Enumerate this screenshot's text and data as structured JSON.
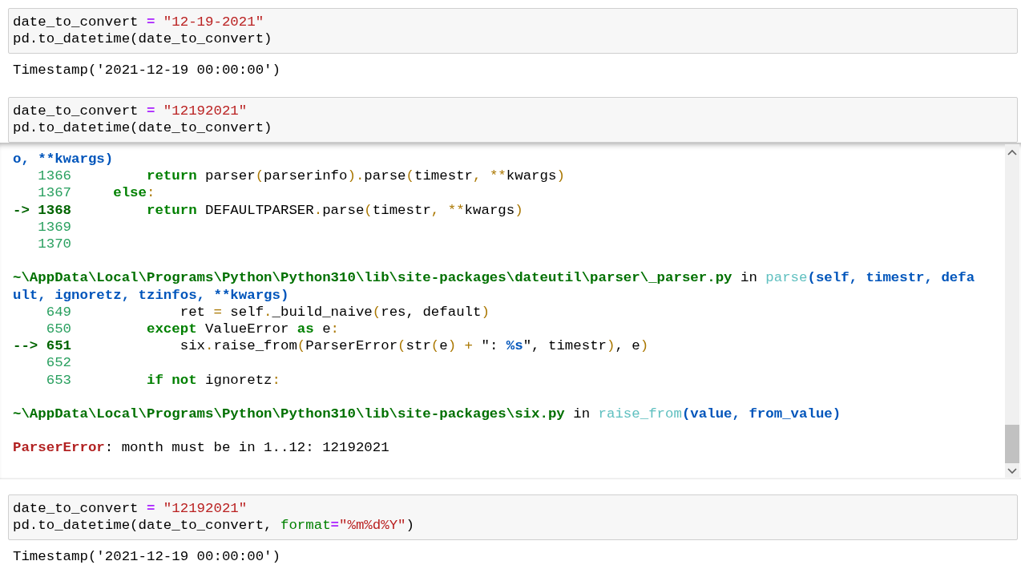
{
  "cells": [
    {
      "input": [
        [
          {
            "text": "date_to_convert ",
            "kind": "plain"
          },
          {
            "text": "=",
            "kind": "op"
          },
          {
            "text": " \"12-19-2021\"",
            "kind": "str"
          }
        ],
        [
          {
            "text": "pd.to_datetime(date_to_convert)",
            "kind": "plain"
          }
        ]
      ],
      "output": {
        "kind": "text",
        "lines": [
          "Timestamp('2021-12-19 00:00:00')"
        ]
      }
    },
    {
      "input": [
        [
          {
            "text": "date_to_convert ",
            "kind": "plain"
          },
          {
            "text": "=",
            "kind": "op"
          },
          {
            "text": " \"12192021\"",
            "kind": "str"
          }
        ],
        [
          {
            "text": "pd.to_datetime(date_to_convert)",
            "kind": "plain"
          }
        ]
      ],
      "output": {
        "kind": "traceback",
        "groups": [
          [
            [
              {
                "text": "o, **kwargs)",
                "kind": "arg"
              }
            ],
            [
              {
                "text": "   1366",
                "kind": "lineno"
              },
              {
                "text": "         return",
                "kind": "kw"
              },
              {
                "text": " parser",
                "kind": "plain"
              },
              {
                "text": "(",
                "kind": "paren"
              },
              {
                "text": "parserinfo",
                "kind": "plain"
              },
              {
                "text": ").",
                "kind": "paren"
              },
              {
                "text": "parse",
                "kind": "plain"
              },
              {
                "text": "(",
                "kind": "paren"
              },
              {
                "text": "timestr",
                "kind": "plain"
              },
              {
                "text": ", **",
                "kind": "paren"
              },
              {
                "text": "kwargs",
                "kind": "plain"
              },
              {
                "text": ")",
                "kind": "paren"
              }
            ],
            [
              {
                "text": "   1367",
                "kind": "lineno"
              },
              {
                "text": "     else",
                "kind": "kw"
              },
              {
                "text": ":",
                "kind": "paren"
              }
            ],
            [
              {
                "text": "-> 1368",
                "kind": "cur"
              },
              {
                "text": "         return",
                "kind": "kw"
              },
              {
                "text": " DEFAULTPARSER",
                "kind": "plain"
              },
              {
                "text": ".",
                "kind": "paren"
              },
              {
                "text": "parse",
                "kind": "plain"
              },
              {
                "text": "(",
                "kind": "paren"
              },
              {
                "text": "timestr",
                "kind": "plain"
              },
              {
                "text": ", **",
                "kind": "paren"
              },
              {
                "text": "kwargs",
                "kind": "plain"
              },
              {
                "text": ")",
                "kind": "paren"
              }
            ],
            [
              {
                "text": "   1369",
                "kind": "lineno"
              }
            ],
            [
              {
                "text": "   1370",
                "kind": "lineno"
              }
            ]
          ],
          [
            [
              {
                "text": "~\\AppData\\Local\\Programs\\Python\\Python310\\lib\\site-packages\\dateutil\\parser\\_parser.py",
                "kind": "path"
              },
              {
                "text": " in ",
                "kind": "plain"
              },
              {
                "text": "parse",
                "kind": "func"
              },
              {
                "text": "(self, timestr, defa",
                "kind": "arg"
              }
            ],
            [
              {
                "text": "ult, ignoretz, tzinfos, **kwargs)",
                "kind": "arg"
              }
            ],
            [
              {
                "text": "    649",
                "kind": "lineno"
              },
              {
                "text": "             ret ",
                "kind": "plain"
              },
              {
                "text": "=",
                "kind": "paren"
              },
              {
                "text": " self",
                "kind": "plain"
              },
              {
                "text": ".",
                "kind": "paren"
              },
              {
                "text": "_build_naive",
                "kind": "plain"
              },
              {
                "text": "(",
                "kind": "paren"
              },
              {
                "text": "res, default",
                "kind": "plain"
              },
              {
                "text": ")",
                "kind": "paren"
              }
            ],
            [
              {
                "text": "    650",
                "kind": "lineno"
              },
              {
                "text": "         except",
                "kind": "kw"
              },
              {
                "text": " ValueError ",
                "kind": "plain"
              },
              {
                "text": "as",
                "kind": "kw"
              },
              {
                "text": " e",
                "kind": "plain"
              },
              {
                "text": ":",
                "kind": "paren"
              }
            ],
            [
              {
                "text": "--> 651",
                "kind": "cur"
              },
              {
                "text": "             six",
                "kind": "plain"
              },
              {
                "text": ".",
                "kind": "paren"
              },
              {
                "text": "raise_from",
                "kind": "plain"
              },
              {
                "text": "(",
                "kind": "paren"
              },
              {
                "text": "ParserError",
                "kind": "plain"
              },
              {
                "text": "(",
                "kind": "paren"
              },
              {
                "text": "str",
                "kind": "plain"
              },
              {
                "text": "(",
                "kind": "paren"
              },
              {
                "text": "e",
                "kind": "plain"
              },
              {
                "text": ") + ",
                "kind": "paren"
              },
              {
                "text": "\": ",
                "kind": "plain"
              },
              {
                "text": "%s",
                "kind": "arg"
              },
              {
                "text": "\", timestr",
                "kind": "plain"
              },
              {
                "text": ")",
                "kind": "paren"
              },
              {
                "text": ", e",
                "kind": "plain"
              },
              {
                "text": ")",
                "kind": "paren"
              }
            ],
            [
              {
                "text": "    652",
                "kind": "lineno"
              }
            ],
            [
              {
                "text": "    653",
                "kind": "lineno"
              },
              {
                "text": "         if not",
                "kind": "kw"
              },
              {
                "text": " ignoretz",
                "kind": "plain"
              },
              {
                "text": ":",
                "kind": "paren"
              }
            ]
          ],
          [
            [
              {
                "text": "~\\AppData\\Local\\Programs\\Python\\Python310\\lib\\site-packages\\six.py",
                "kind": "path"
              },
              {
                "text": " in ",
                "kind": "plain"
              },
              {
                "text": "raise_from",
                "kind": "func"
              },
              {
                "text": "(value, from_value)",
                "kind": "arg"
              }
            ]
          ],
          [
            [
              {
                "text": "ParserError",
                "kind": "err"
              },
              {
                "text": ": month must be in 1..12: 12192021",
                "kind": "plain"
              }
            ]
          ]
        ]
      }
    },
    {
      "input": [
        [
          {
            "text": "date_to_convert ",
            "kind": "plain"
          },
          {
            "text": "=",
            "kind": "op"
          },
          {
            "text": " \"12192021\"",
            "kind": "str"
          }
        ],
        [
          {
            "text": "pd.to_datetime(date_to_convert, ",
            "kind": "plain"
          },
          {
            "text": "format",
            "kind": "name"
          },
          {
            "text": "=",
            "kind": "op"
          },
          {
            "text": "\"%m%d%Y\"",
            "kind": "str"
          },
          {
            "text": ")",
            "kind": "plain"
          }
        ]
      ],
      "output": {
        "kind": "text",
        "lines": [
          "Timestamp('2021-12-19 00:00:00')"
        ]
      }
    }
  ]
}
